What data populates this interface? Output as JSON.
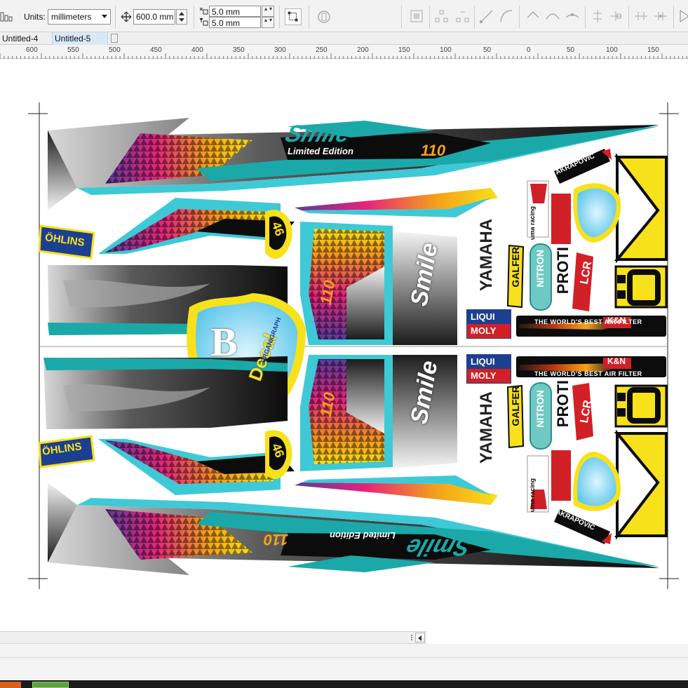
{
  "propbar": {
    "units_label": "Units:",
    "units_value": "millimeters",
    "nudge_value": "600.0 mm",
    "dup_x_value": "5.0 mm",
    "dup_y_value": "5.0 mm"
  },
  "tabs": [
    {
      "label": "Untitled-4"
    },
    {
      "label": "Untitled-5"
    }
  ],
  "ruler": {
    "labels": [
      "600",
      "550",
      "500",
      "450",
      "400",
      "350",
      "300",
      "250",
      "200",
      "150",
      "100",
      "50",
      "0",
      "50",
      "100",
      "150"
    ]
  },
  "design": {
    "brand_top": "Smile",
    "edition_text": "Limited Edition",
    "edition_number": "110",
    "ohlins": "ÖHLINS",
    "number_46": "46",
    "decal_brand": "Decal",
    "decal_letter": "B",
    "decal_sub": "ORGANIGRAPH",
    "yamaha": "YAMAHA",
    "galfer": "GALFER",
    "nitron": "NITRON",
    "proti": "PROTI",
    "lcr": "LCR",
    "liqui": "LIQUI",
    "moly": "MOLY",
    "uma": "uma racing",
    "akrapovic": "AKRAPOVIC",
    "kn": "K&N",
    "kn_tagline": "THE WORLD'S BEST AIR FILTER",
    "side_110": "110",
    "smile_side": "Smile",
    "zero_plate": "0"
  },
  "colors": {
    "teal": "#1aa9a8",
    "cyan": "#3ec9d6",
    "yellow": "#f7e11b",
    "pink": "#e5247b",
    "orange": "#f5a11a",
    "purple": "#5b3a9b",
    "black": "#0c0c0c",
    "grey": "#8c8c8c"
  }
}
